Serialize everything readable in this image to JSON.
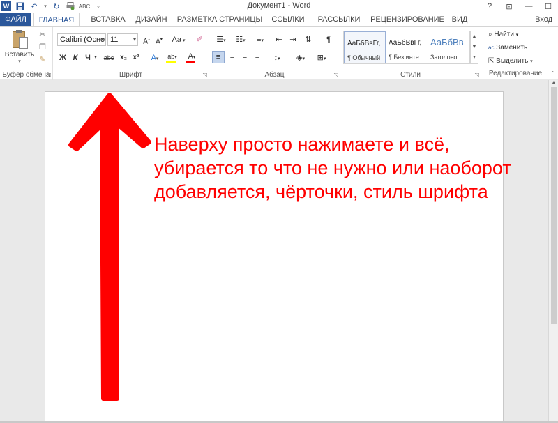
{
  "titlebar": {
    "document_title": "Документ1 - Word",
    "help": "?",
    "restore_ribbon": "⊡",
    "minimize": "—",
    "maximize": "☐"
  },
  "tabs": {
    "file": "ФАЙЛ",
    "items": [
      "ГЛАВНАЯ",
      "ВСТАВКА",
      "ДИЗАЙН",
      "РАЗМЕТКА СТРАНИЦЫ",
      "ССЫЛКИ",
      "РАССЫЛКИ",
      "РЕЦЕНЗИРОВАНИЕ",
      "ВИД"
    ],
    "login": "Вход"
  },
  "ribbon": {
    "clipboard": {
      "paste_label": "Вставить",
      "group_label": "Буфер обмена"
    },
    "font": {
      "font_name": "Calibri (Осно",
      "font_size": "11",
      "grow": "A",
      "shrink": "A",
      "case": "Aa",
      "bold": "Ж",
      "italic": "К",
      "underline": "Ч",
      "strike": "abc",
      "subscript": "x₂",
      "superscript": "x²",
      "highlight_label": "ab",
      "color_label": "A",
      "group_label": "Шрифт"
    },
    "paragraph": {
      "pilcrow": "¶",
      "group_label": "Абзац"
    },
    "styles": {
      "items": [
        {
          "sample": "АаБбВвГг,",
          "name": "¶ Обычный"
        },
        {
          "sample": "АаБбВвГг,",
          "name": "¶ Без инте..."
        },
        {
          "sample": "АаБбВв",
          "name": "Заголово..."
        }
      ],
      "group_label": "Стили"
    },
    "editing": {
      "find": "Найти",
      "replace": "Заменить",
      "select": "Выделить",
      "group_label": "Редактирование"
    }
  },
  "document": {
    "annotation_lines": [
      "Наверху просто нажимаете и всё,",
      "убирается то что не нужно или наоборот",
      "добавляется, чёрточки, стиль шрифта"
    ]
  },
  "colors": {
    "accent": "#2b579a",
    "annotation": "#ff0000",
    "highlight": "#ffff00",
    "font_color": "#ff0000"
  }
}
